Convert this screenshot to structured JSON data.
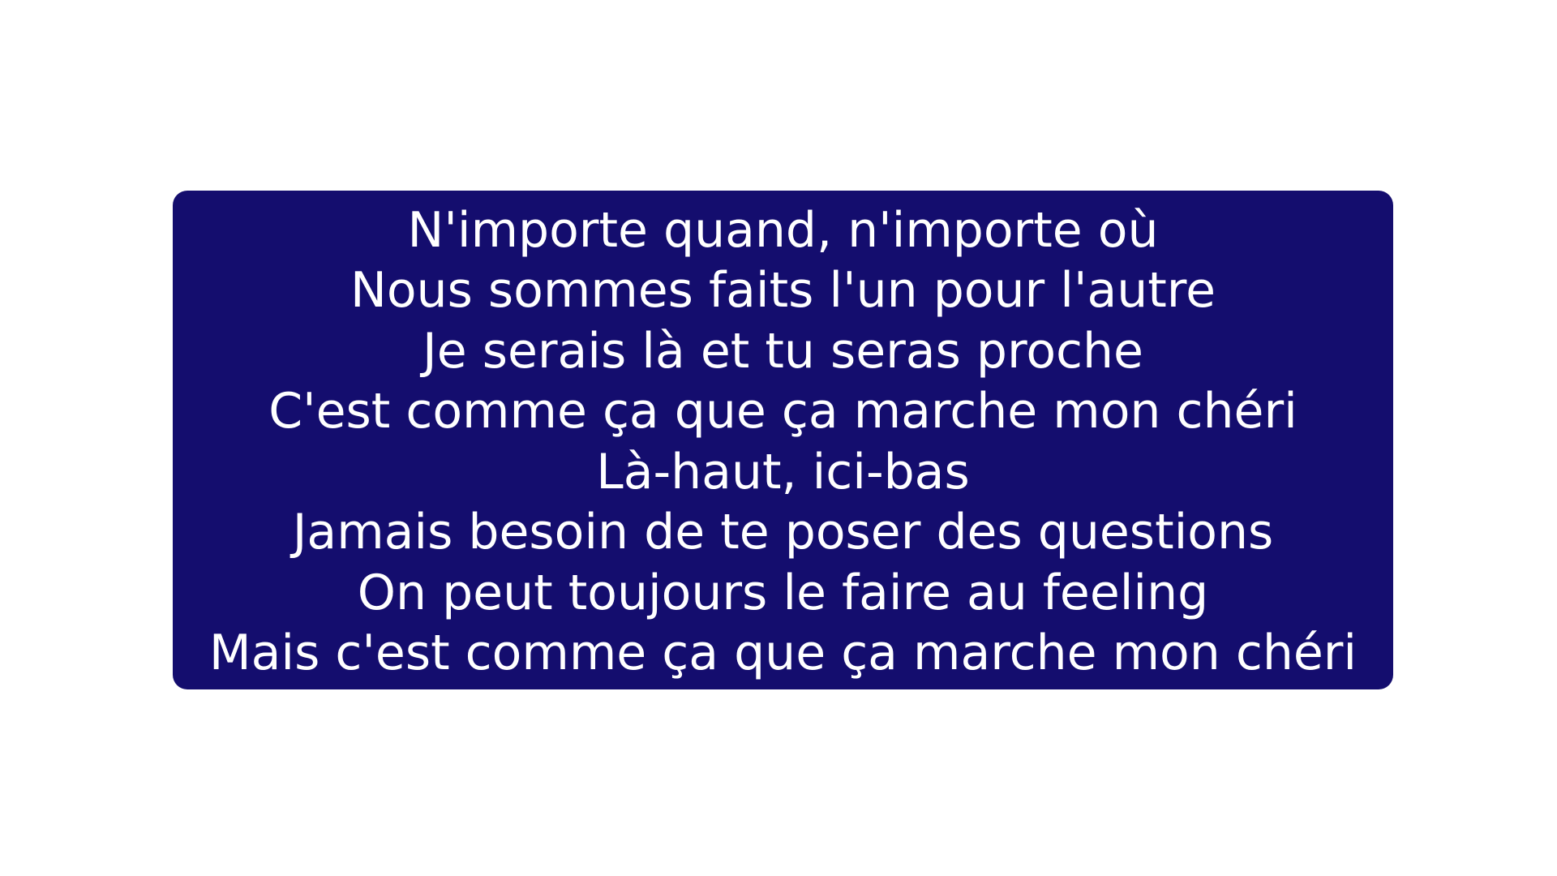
{
  "colors": {
    "background": "#ffffff",
    "box_background": "#140d6e",
    "text": "#ffffff"
  },
  "lyrics": {
    "lines": [
      "N'importe quand, n'importe où",
      "Nous sommes faits l'un pour l'autre",
      "Je serais là et tu seras proche",
      "C'est comme ça que ça marche mon chéri",
      "Là-haut, ici-bas",
      "Jamais besoin de te poser des questions",
      "On peut toujours le faire au feeling",
      "Mais c'est comme ça que ça marche mon chéri"
    ]
  }
}
